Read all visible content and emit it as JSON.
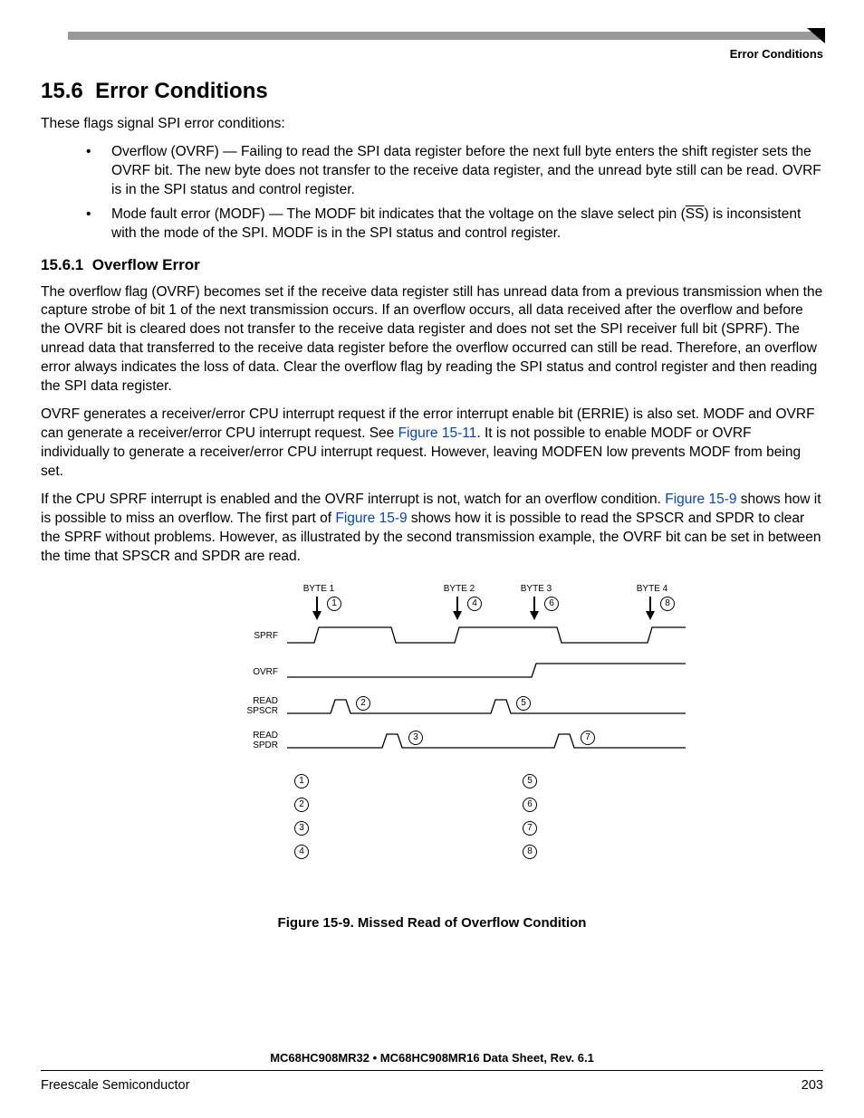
{
  "running_head": "Error Conditions",
  "section": {
    "number": "15.6",
    "title": "Error Conditions",
    "intro": "These flags signal SPI error conditions:",
    "bullets": [
      "Overflow (OVRF) — Failing to read the SPI data register before the next full byte enters the shift register sets the OVRF bit. The new byte does not transfer to the receive data register, and the unread byte still can be read. OVRF is in the SPI status and control register.",
      "Mode fault error (MODF) — The MODF bit indicates that the voltage on the slave select pin (SS) is inconsistent with the mode of the SPI. MODF is in the SPI status and control register."
    ]
  },
  "subsection": {
    "number": "15.6.1",
    "title": "Overflow Error",
    "p1": "The overflow flag (OVRF) becomes set if the receive data register still has unread data from a previous transmission when the capture strobe of bit 1 of the next transmission occurs. If an overflow occurs, all data received after the overflow and before the OVRF bit is cleared does not transfer to the receive data register and does not set the SPI receiver full bit (SPRF). The unread data that transferred to the receive data register before the overflow occurred can still be read. Therefore, an overflow error always indicates the loss of data. Clear the overflow flag by reading the SPI status and control register and then reading the SPI data register.",
    "p2_a": "OVRF generates a receiver/error CPU interrupt request if the error interrupt enable bit (ERRIE) is also set. MODF and OVRF can generate a receiver/error CPU interrupt request. See ",
    "p2_link": "Figure 15-11",
    "p2_b": ". It is not possible to enable MODF or OVRF individually to generate a receiver/error CPU interrupt request. However, leaving MODFEN low prevents MODF from being set.",
    "p3_a": "If the CPU SPRF interrupt is enabled and the OVRF interrupt is not, watch for an overflow condition. ",
    "p3_link1": "Figure 15-9",
    "p3_b": " shows how it is possible to miss an overflow. The first part of ",
    "p3_link2": "Figure 15-9",
    "p3_c": " shows how it is possible to read the SPSCR and SPDR to clear the SPRF without problems. However, as illustrated by the second transmission example, the OVRF bit can be set in between the time that SPSCR and SPDR are read."
  },
  "figure": {
    "byte_labels": [
      "BYTE 1",
      "BYTE 2",
      "BYTE 3",
      "BYTE 4"
    ],
    "signal_labels": [
      "SPRF",
      "OVRF",
      "READ SPSCR",
      "READ SPDR"
    ],
    "caption": "Figure 15-9. Missed Read of Overflow Condition",
    "step_numbers_left": [
      "1",
      "2",
      "3",
      "4"
    ],
    "step_numbers_right": [
      "5",
      "6",
      "7",
      "8"
    ]
  },
  "footer": {
    "doc_title": "MC68HC908MR32 • MC68HC908MR16 Data Sheet, Rev. 6.1",
    "vendor": "Freescale Semiconductor",
    "page": "203"
  }
}
